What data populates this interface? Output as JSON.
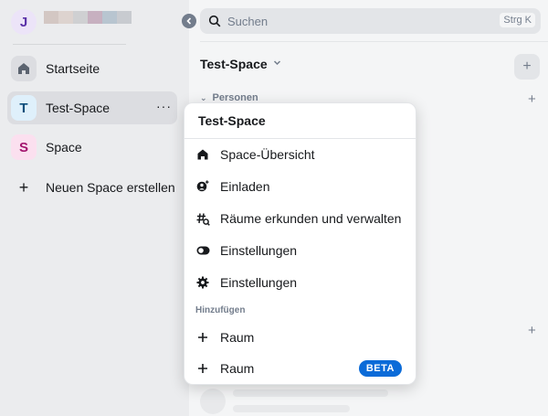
{
  "user": {
    "initial": "J"
  },
  "sidebar": {
    "items": [
      {
        "label": "Startseite",
        "tile": "",
        "tile_color": "#5c6470",
        "tile_bg": "#dcdde1"
      },
      {
        "label": "Test-Space",
        "tile": "T",
        "tile_color": "#0b4d7a",
        "tile_bg": "#dff0fb",
        "more": "···"
      },
      {
        "label": "Space",
        "tile": "S",
        "tile_color": "#a3156e",
        "tile_bg": "#fbe0ef"
      },
      {
        "label": "Neuen Space erstellen",
        "tile": "+"
      }
    ]
  },
  "search": {
    "placeholder": "Suchen",
    "shortcut": "Strg K"
  },
  "main": {
    "title": "Test-Space",
    "section_label": "Personen",
    "add_symbol": "+"
  },
  "menu": {
    "title": "Test-Space",
    "items": [
      {
        "label": "Space-Übersicht",
        "icon": "home-icon"
      },
      {
        "label": "Einladen",
        "icon": "invite-icon"
      },
      {
        "label": "Räume erkunden und verwalten",
        "icon": "explore-rooms-icon"
      },
      {
        "label": "Einstellungen",
        "icon": "toggle-icon"
      },
      {
        "label": "Einstellungen",
        "icon": "gear-icon"
      }
    ],
    "add_header": "Hinzufügen",
    "add_items": [
      {
        "label": "Raum",
        "icon": "plus-icon"
      },
      {
        "label": "Raum",
        "icon": "plus-icon",
        "badge": "BETA"
      }
    ]
  },
  "colors": {
    "accent": "#0b6bd8",
    "sidebar_bg": "#ebecee",
    "secondary_text": "#737d8c"
  }
}
